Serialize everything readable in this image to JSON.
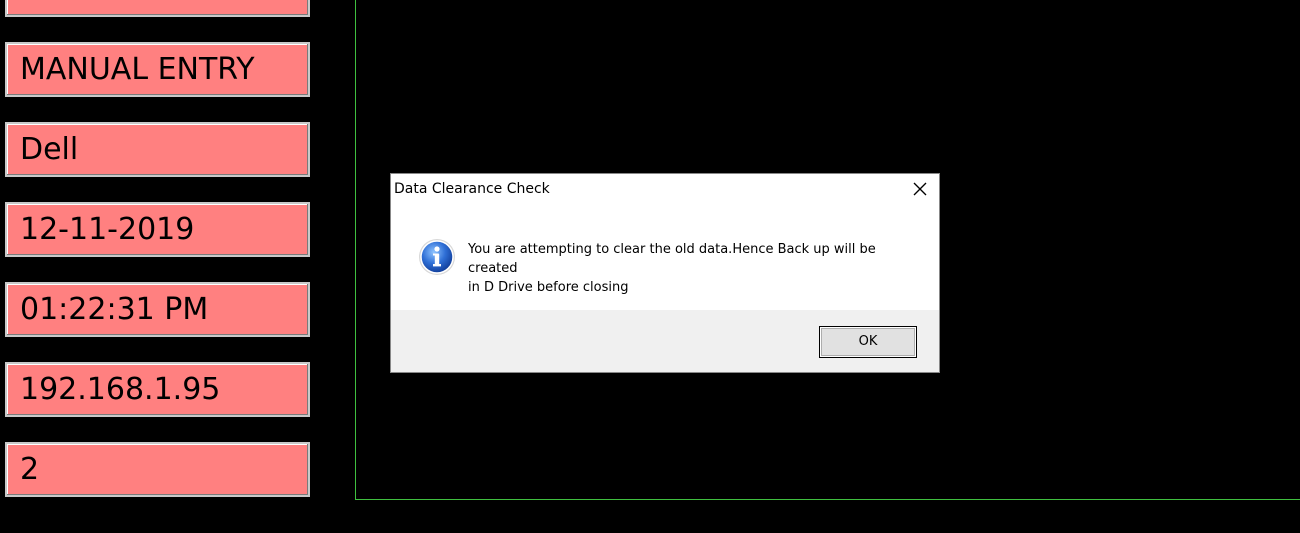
{
  "info_boxes": [
    {
      "text": ""
    },
    {
      "text": "MANUAL ENTRY"
    },
    {
      "text": "Dell"
    },
    {
      "text": "12-11-2019"
    },
    {
      "text": "01:22:31 PM"
    },
    {
      "text": "192.168.1.95"
    },
    {
      "text": "2"
    }
  ],
  "dialog": {
    "title": "Data Clearance Check",
    "message_line1": "You are attempting to clear the old data.Hence Back up will be created",
    "message_line2": "in D Drive before closing",
    "ok_label": "OK",
    "icon": "info-icon",
    "close_icon": "close-icon"
  },
  "colors": {
    "info_box_bg": "#ff8080",
    "background": "#000000",
    "panel_border": "#3fbf3f",
    "dialog_footer": "#f0f0f0"
  }
}
